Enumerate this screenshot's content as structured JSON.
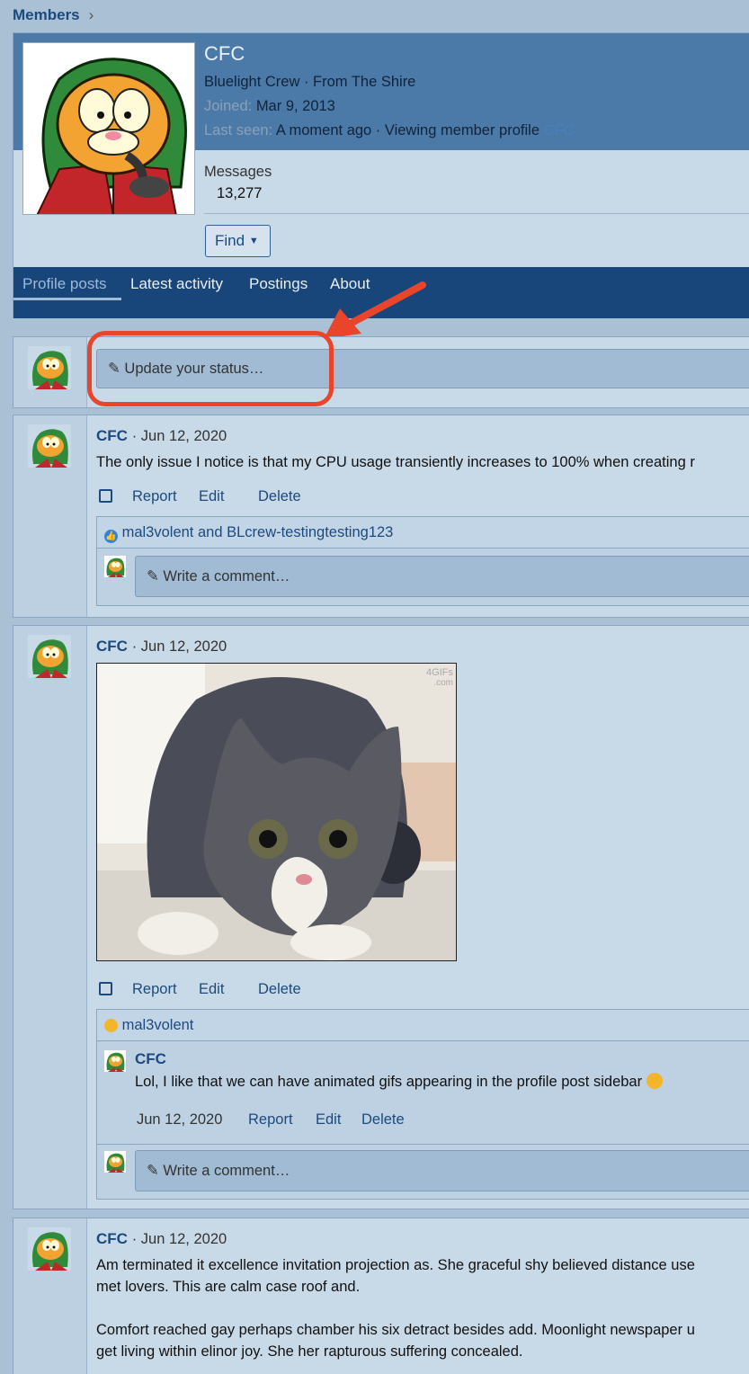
{
  "breadcrumb": {
    "label": "Members"
  },
  "profile": {
    "name": "CFC",
    "title_line": "Bluelight Crew · From The Shire",
    "joined_label": "Joined:",
    "joined_value": "Mar 9, 2013",
    "last_seen_label": "Last seen:",
    "last_seen_value": "A moment ago · Viewing member profile",
    "last_seen_link": "CFC",
    "messages_label": "Messages",
    "messages_value": "13,277",
    "find_label": "Find"
  },
  "tabs": [
    "Profile posts",
    "Latest activity",
    "Postings",
    "About"
  ],
  "status_placeholder": "Update your status…",
  "posts": [
    {
      "author": "CFC",
      "date": "· Jun 12, 2020",
      "text": "The only issue I notice is that my CPU usage transiently increases to 100% when creating r",
      "actions": [
        "Report",
        "Edit",
        "Delete"
      ],
      "reactions": "mal3volent and BLcrew-testingtesting123",
      "comment_placeholder": "Write a comment…"
    },
    {
      "author": "CFC",
      "date": "· Jun 12, 2020",
      "image_watermark_1": "4GIFs",
      "image_watermark_2": ".com",
      "actions": [
        "Report",
        "Edit",
        "Delete"
      ],
      "reactions": "mal3volent",
      "comment": {
        "author": "CFC",
        "text": "Lol, I like that we can have animated gifs appearing in the profile post sidebar",
        "date": "Jun 12, 2020",
        "actions": [
          "Report",
          "Edit",
          "Delete"
        ]
      },
      "comment_placeholder": "Write a comment…"
    },
    {
      "author": "CFC",
      "date": "· Jun 12, 2020",
      "para1_line1": "Am terminated it excellence invitation projection as. She graceful shy believed distance use",
      "para1_line2": "met lovers. This are calm case roof and.",
      "para2_line1": "Comfort reached gay perhaps chamber his six detract besides add. Moonlight newspaper u",
      "para2_line2": "get living within elinor joy. She her rapturous suffering concealed."
    }
  ],
  "colors": {
    "accent": "#1d4a7e",
    "tab_bar": "#18457a",
    "annotation": "#e8452a"
  }
}
